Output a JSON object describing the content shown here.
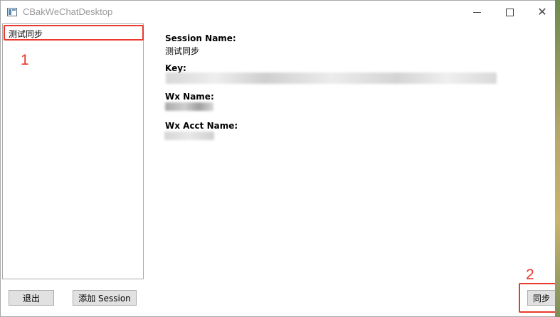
{
  "window": {
    "title": "CBakWeChatDesktop",
    "controls": {
      "minimize": "minimize-icon",
      "maximize": "maximize-icon",
      "close": "close-icon"
    }
  },
  "sessions": {
    "items": [
      {
        "label": "测试同步"
      }
    ]
  },
  "details": {
    "session_name_label": "Session Name:",
    "session_name_value": "测试同步",
    "key_label": "Key:",
    "wx_name_label": "Wx Name:",
    "wx_acct_name_label": "Wx Acct Name:"
  },
  "buttons": {
    "exit": "退出",
    "add_session": "添加 Session",
    "sync": "同步"
  },
  "annotations": {
    "one": "1",
    "two": "2"
  },
  "colors": {
    "annotation": "#e8392c",
    "button_bg": "#e1e1e1"
  }
}
